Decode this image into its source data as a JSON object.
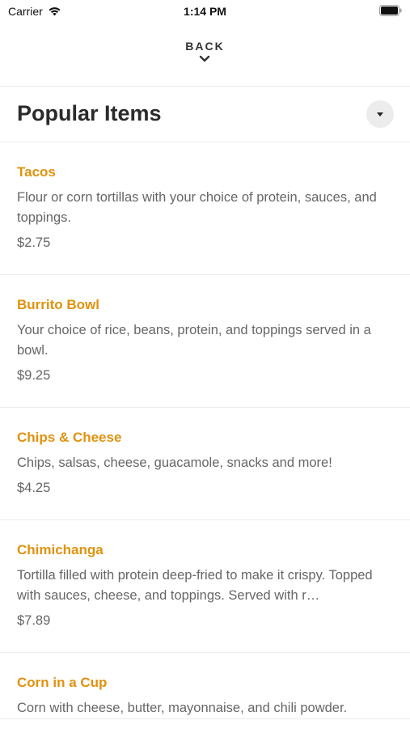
{
  "status_bar": {
    "carrier": "Carrier",
    "time": "1:14 PM"
  },
  "nav": {
    "back_label": "BACK"
  },
  "header": {
    "title": "Popular Items"
  },
  "items": [
    {
      "name": "Tacos",
      "description": "Flour or corn tortillas with your choice of protein, sauces, and toppings.",
      "price": "$2.75"
    },
    {
      "name": "Burrito Bowl",
      "description": "Your choice of rice, beans, protein, and toppings served in a bowl.",
      "price": "$9.25"
    },
    {
      "name": "Chips & Cheese",
      "description": "Chips, salsas, cheese, guacamole, snacks and more!",
      "price": "$4.25"
    },
    {
      "name": "Chimichanga",
      "description": "Tortilla filled with protein deep-fried to make it crispy. Topped with sauces, cheese, and toppings. Served with r…",
      "price": "$7.89"
    },
    {
      "name": "Corn in a Cup",
      "description": "Corn with cheese, butter, mayonnaise, and chili powder."
    }
  ],
  "colors": {
    "accent": "#e0920d",
    "text": "#666666",
    "title": "#2b2b2b",
    "divider": "#ececec"
  },
  "icons": {
    "wifi": "wifi-icon",
    "battery": "battery-icon",
    "back_chevron": "chevron-down-icon",
    "dropdown": "caret-down-icon"
  }
}
